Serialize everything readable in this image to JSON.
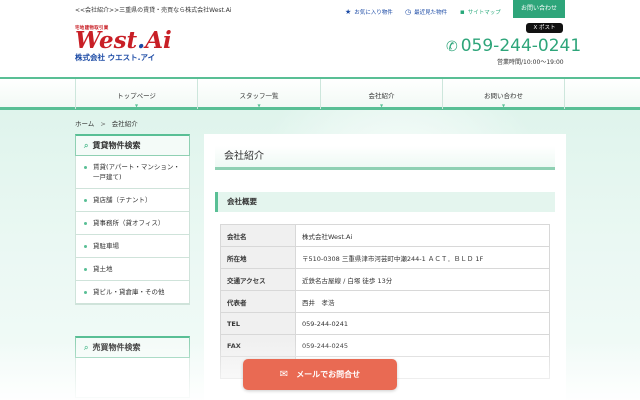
{
  "header": {
    "tagline": "<<会社紹介>>三重県の賃貸・売買なら株式会社West.Ai",
    "logo": {
      "small_text": "宅地建物取引業",
      "main_text": "West",
      "dot": ".",
      "suffix": "Ai",
      "sub_text": "株式会社 ウエスト.アイ"
    },
    "links": {
      "favorites": "お気に入り物件",
      "recent": "最近見た物件",
      "sitemap": "サイトマップ"
    },
    "contact_button": "お問い合わせ",
    "x_post": "ポスト",
    "phone": "059-244-0241",
    "hours": "営業時間/10:00～19:00"
  },
  "nav": {
    "items": [
      {
        "label": "トップページ"
      },
      {
        "label": "スタッフ一覧"
      },
      {
        "label": "会社紹介"
      },
      {
        "label": "お問い合わせ"
      }
    ]
  },
  "breadcrumb": {
    "home": "ホーム",
    "separator": ">",
    "current": "会社紹介"
  },
  "sidebar": {
    "rental_title": "賃貸物件検索",
    "rental_items": [
      {
        "label": "賃貸(アパート・マンション・一戸建て)"
      },
      {
        "label": "貸店舗（テナント）"
      },
      {
        "label": "貸事務所（貸オフィス）"
      },
      {
        "label": "貸駐車場"
      },
      {
        "label": "貸土地"
      },
      {
        "label": "貸ビル・貸倉庫・その他"
      }
    ],
    "sale_title": "売買物件検索"
  },
  "content": {
    "page_title": "会社紹介",
    "section_title": "会社概要",
    "rows": [
      {
        "label": "会社名",
        "value": "株式会社West.Ai"
      },
      {
        "label": "所在地",
        "value": "〒510-0308 三重県津市河芸町中瀬244-1 ＡＣＴ．ＢＬＤ 1F"
      },
      {
        "label": "交通アクセス",
        "value": "近鉄名古屋線 / 白塚 徒歩 13分"
      },
      {
        "label": "代表者",
        "value": "西井　孝浩"
      },
      {
        "label": "TEL",
        "value": "059-244-0241"
      },
      {
        "label": "FAX",
        "value": "059-244-0245"
      }
    ]
  },
  "mail_button": "メールでお問合せ",
  "colors": {
    "brand_green": "#59bf95",
    "brand_red": "#c81f26",
    "brand_blue": "#1b4aa5",
    "mail_button": "#e96a53"
  },
  "icons": {
    "favorites": "star-icon",
    "recent": "clock-icon",
    "sitemap": "sitemap-icon",
    "phone": "phone-icon",
    "sidebar": "search-icon",
    "mail": "envelope-icon"
  }
}
